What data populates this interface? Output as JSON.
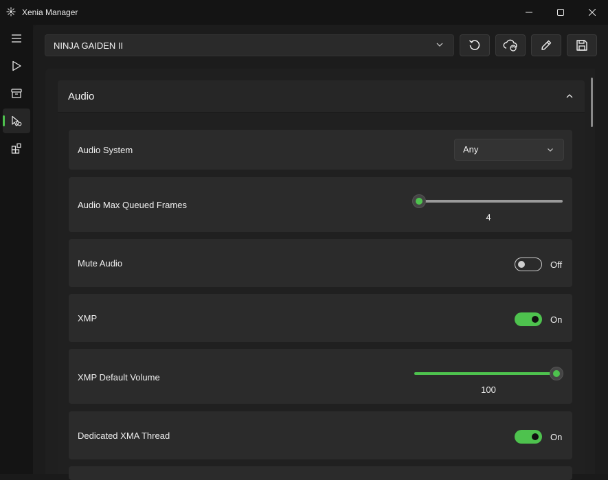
{
  "window": {
    "title": "Xenia Manager",
    "icon": "xenia-logo-icon",
    "controls": {
      "minimize": "minimize-icon",
      "maximize": "maximize-icon",
      "close": "close-icon"
    }
  },
  "nav": {
    "items": [
      {
        "icon": "menu-icon"
      },
      {
        "icon": "play-icon"
      },
      {
        "icon": "library-icon"
      },
      {
        "icon": "game-settings-icon",
        "active": true
      },
      {
        "icon": "add-ons-icon"
      }
    ]
  },
  "toolbar": {
    "game_select": {
      "value": "NINJA GAIDEN II",
      "icon": "chevron-down-icon"
    },
    "buttons": [
      {
        "icon": "reset-icon"
      },
      {
        "icon": "cloud-sync-icon"
      },
      {
        "icon": "edit-pen-icon"
      },
      {
        "icon": "save-icon"
      }
    ]
  },
  "section": {
    "title": "Audio",
    "icon": "chevron-up-icon"
  },
  "settings": {
    "audio_system": {
      "label": "Audio System",
      "value": "Any"
    },
    "audio_max_queued_frames": {
      "label": "Audio Max Queued Frames",
      "value": "4",
      "level": 0
    },
    "mute_audio": {
      "label": "Mute Audio",
      "state": "Off"
    },
    "xmp": {
      "label": "XMP",
      "state": "On"
    },
    "xmp_default_volume": {
      "label": "XMP Default Volume",
      "value": "100",
      "level": 1
    },
    "dedicated_xma_thread": {
      "label": "Dedicated XMA Thread",
      "state": "On"
    }
  },
  "colors": {
    "accent": "#4ec24e",
    "background": "#1a1a1a",
    "card": "#2b2b2b"
  }
}
